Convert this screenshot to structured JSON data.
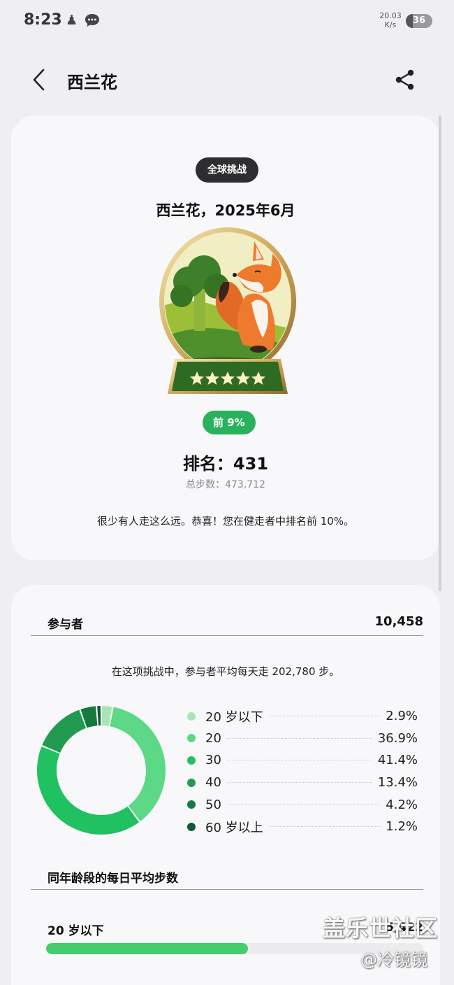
{
  "status_bar": {
    "time": "8:23",
    "net_speed_value": "20.03",
    "net_speed_unit": "K/s",
    "battery": "36"
  },
  "header": {
    "title": "西兰花"
  },
  "challenge": {
    "chip": "全球挑战",
    "title": "西兰花，2025年6月",
    "badge_stars": 5,
    "rank_percent": "前 9%",
    "rank_line": "排名：431",
    "total_steps": "总步数：473,712",
    "message": "很少有人走这么远。恭喜！您在健走者中排名前 10%。"
  },
  "participants": {
    "label": "参与者",
    "count": "10,458",
    "avg_text": "在这项挑战中，参与者平均每天走 202,780 步。",
    "chart_data": {
      "type": "pie",
      "style": "donut",
      "categories": [
        "20 岁以下",
        "20",
        "30",
        "40",
        "50",
        "60 岁以上"
      ],
      "values": [
        2.9,
        36.9,
        41.4,
        13.4,
        4.2,
        1.2
      ],
      "value_labels": [
        "2.9%",
        "36.9%",
        "41.4%",
        "13.4%",
        "4.2%",
        "1.2%"
      ],
      "colors": [
        "#a7e6b4",
        "#5dd886",
        "#1fc160",
        "#239a51",
        "#147a40",
        "#0f5a36"
      ],
      "legend_position": "right"
    }
  },
  "age_avg": {
    "title": "同年龄段的每日平均步数",
    "rows": [
      {
        "label": "20 岁以下",
        "value": "5,422",
        "fraction": 0.535
      }
    ]
  },
  "watermark": {
    "main": "盖乐世社区",
    "sub": "@冷镜镜"
  }
}
